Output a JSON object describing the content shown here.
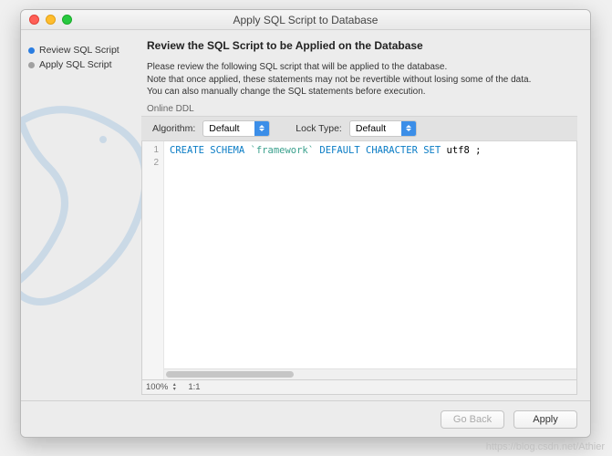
{
  "window": {
    "title": "Apply SQL Script to Database"
  },
  "sidebar": {
    "items": [
      {
        "label": "Review SQL Script",
        "active": true
      },
      {
        "label": "Apply SQL Script",
        "active": false
      }
    ]
  },
  "main": {
    "title": "Review the SQL Script to be Applied on the Database",
    "instructions_line1": "Please review the following SQL script that will be applied to the database.",
    "instructions_line2": "Note that once applied, these statements may not be revertible without losing some of the data.",
    "instructions_line3": "You can also manually change the SQL statements before execution.",
    "ddl_label": "Online DDL",
    "algorithm_label": "Algorithm:",
    "algorithm_value": "Default",
    "locktype_label": "Lock Type:",
    "locktype_value": "Default"
  },
  "editor": {
    "lines": [
      "1",
      "2"
    ],
    "sql": {
      "kw1": "CREATE",
      "kw2": "SCHEMA",
      "ident": "`framework`",
      "kw3": "DEFAULT",
      "kw4": "CHARACTER",
      "kw5": "SET",
      "tail": "utf8 ;"
    },
    "zoom": "100%",
    "cursor": "1:1"
  },
  "buttons": {
    "back": "Go Back",
    "apply": "Apply"
  },
  "watermark": "https://blog.csdn.net/Athier"
}
